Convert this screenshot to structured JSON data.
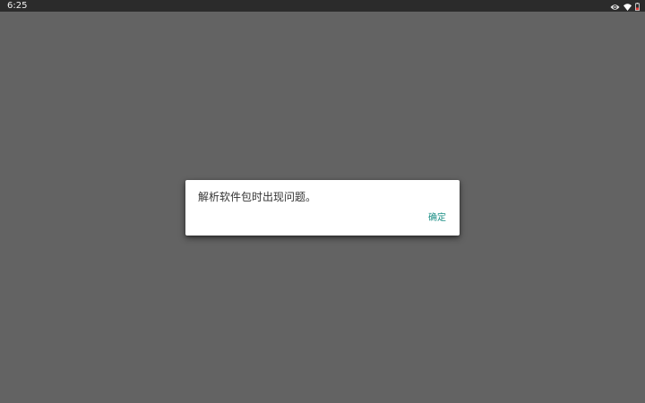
{
  "status_bar": {
    "time": "6:25",
    "icons": [
      "eye-icon",
      "wifi-icon",
      "battery-icon"
    ]
  },
  "dialog": {
    "message": "解析软件包时出现问题。",
    "ok_label": "确定"
  },
  "colors": {
    "background": "#636363",
    "status_bar": "#2b2b2b",
    "accent": "#1c8f86",
    "battery_low": "#e53935"
  }
}
